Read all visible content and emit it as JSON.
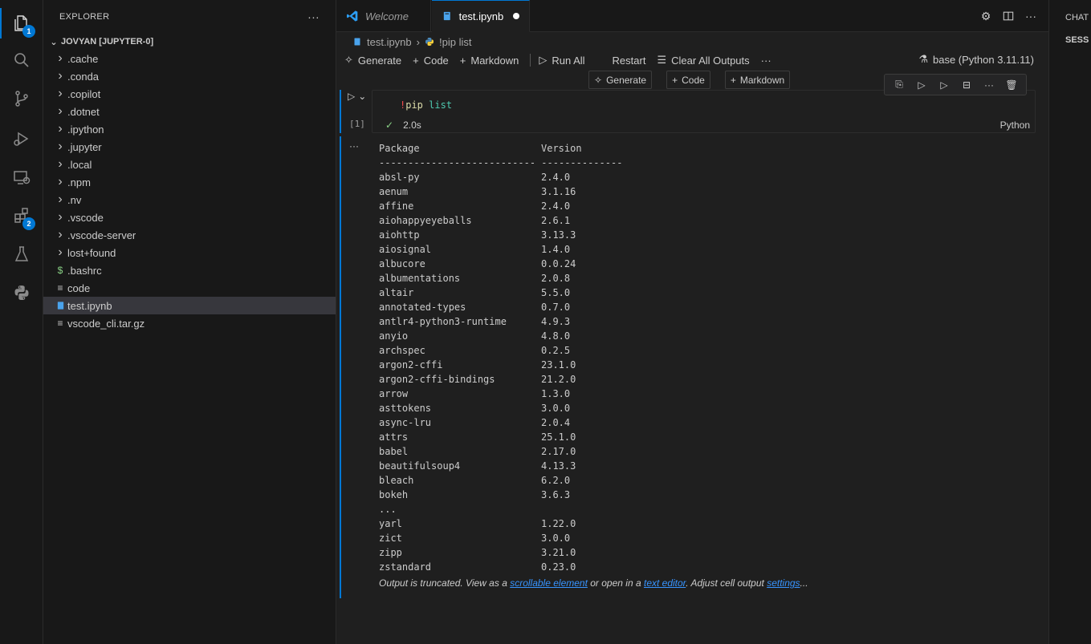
{
  "activity_bar": {
    "explorer_badge": "1",
    "extensions_badge": "2"
  },
  "sidebar": {
    "title": "EXPLORER",
    "more": "···",
    "folder": "JOVYAN [JUPYTER-0]",
    "items": [
      {
        "label": ".cache",
        "type": "folder"
      },
      {
        "label": ".conda",
        "type": "folder"
      },
      {
        "label": ".copilot",
        "type": "folder"
      },
      {
        "label": ".dotnet",
        "type": "folder"
      },
      {
        "label": ".ipython",
        "type": "folder"
      },
      {
        "label": ".jupyter",
        "type": "folder"
      },
      {
        "label": ".local",
        "type": "folder"
      },
      {
        "label": ".npm",
        "type": "folder"
      },
      {
        "label": ".nv",
        "type": "folder"
      },
      {
        "label": ".vscode",
        "type": "folder"
      },
      {
        "label": ".vscode-server",
        "type": "folder"
      },
      {
        "label": "lost+found",
        "type": "folder"
      },
      {
        "label": ".bashrc",
        "type": "shell"
      },
      {
        "label": "code",
        "type": "file"
      },
      {
        "label": "test.ipynb",
        "type": "notebook",
        "selected": true
      },
      {
        "label": "vscode_cli.tar.gz",
        "type": "file"
      }
    ]
  },
  "tabs": {
    "welcome": "Welcome",
    "active": "test.ipynb"
  },
  "breadcrumb": {
    "file": "test.ipynb",
    "cell": "!pip list"
  },
  "toolbar": {
    "generate": "Generate",
    "code": "Code",
    "markdown": "Markdown",
    "run_all": "Run All",
    "restart": "Restart",
    "clear_outputs": "Clear All Outputs",
    "more": "···",
    "kernel": "base (Python 3.11.11)"
  },
  "insert_bar": {
    "generate": "Generate",
    "code": "Code",
    "markdown": "Markdown"
  },
  "cell": {
    "code_bang": "!",
    "code_cmd": "pip",
    "code_arg": "list",
    "exec_count": "[1]",
    "duration": "2.0s",
    "language": "Python"
  },
  "output": {
    "header_package": "Package",
    "header_version": "Version",
    "divider": "--------------------------- --------------",
    "rows": [
      {
        "name": "absl-py",
        "version": "2.4.0"
      },
      {
        "name": "aenum",
        "version": "3.1.16"
      },
      {
        "name": "affine",
        "version": "2.4.0"
      },
      {
        "name": "aiohappyeyeballs",
        "version": "2.6.1"
      },
      {
        "name": "aiohttp",
        "version": "3.13.3"
      },
      {
        "name": "aiosignal",
        "version": "1.4.0"
      },
      {
        "name": "albucore",
        "version": "0.0.24"
      },
      {
        "name": "albumentations",
        "version": "2.0.8"
      },
      {
        "name": "altair",
        "version": "5.5.0"
      },
      {
        "name": "annotated-types",
        "version": "0.7.0"
      },
      {
        "name": "antlr4-python3-runtime",
        "version": "4.9.3"
      },
      {
        "name": "anyio",
        "version": "4.8.0"
      },
      {
        "name": "archspec",
        "version": "0.2.5"
      },
      {
        "name": "argon2-cffi",
        "version": "23.1.0"
      },
      {
        "name": "argon2-cffi-bindings",
        "version": "21.2.0"
      },
      {
        "name": "arrow",
        "version": "1.3.0"
      },
      {
        "name": "asttokens",
        "version": "3.0.0"
      },
      {
        "name": "async-lru",
        "version": "2.0.4"
      },
      {
        "name": "attrs",
        "version": "25.1.0"
      },
      {
        "name": "babel",
        "version": "2.17.0"
      },
      {
        "name": "beautifulsoup4",
        "version": "4.13.3"
      },
      {
        "name": "bleach",
        "version": "6.2.0"
      },
      {
        "name": "bokeh",
        "version": "3.6.3"
      },
      {
        "name": "...",
        "version": ""
      },
      {
        "name": "yarl",
        "version": "1.22.0"
      },
      {
        "name": "zict",
        "version": "3.0.0"
      },
      {
        "name": "zipp",
        "version": "3.21.0"
      },
      {
        "name": "zstandard",
        "version": "0.23.0"
      }
    ],
    "truncated_prefix": "Output is truncated. View as a ",
    "link_scrollable": "scrollable element",
    "truncated_mid": " or open in a ",
    "link_editor": "text editor",
    "truncated_mid2": ". Adjust cell output ",
    "link_settings": "settings",
    "truncated_suffix": "..."
  },
  "right_panel": {
    "title": "CHAT",
    "subtitle": "SESS"
  },
  "colors": {
    "accent": "#0078d4",
    "link": "#3794ff",
    "success": "#89d185"
  }
}
